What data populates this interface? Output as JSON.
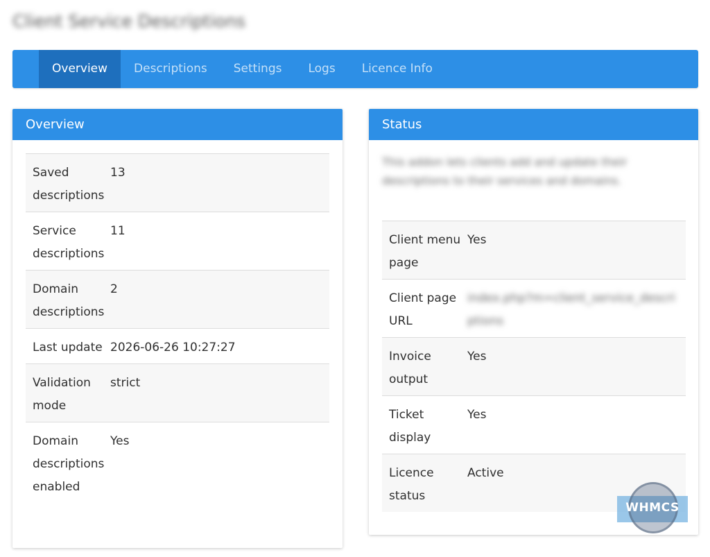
{
  "page": {
    "title": "Client Service Descriptions"
  },
  "nav": {
    "tabs": [
      {
        "label": "Overview",
        "active": true
      },
      {
        "label": "Descriptions",
        "active": false
      },
      {
        "label": "Settings",
        "active": false
      },
      {
        "label": "Logs",
        "active": false
      },
      {
        "label": "Licence Info",
        "active": false
      }
    ]
  },
  "overview": {
    "title": "Overview",
    "rows": [
      {
        "label": "Saved descriptions",
        "value": "13"
      },
      {
        "label": "Service descriptions",
        "value": "11"
      },
      {
        "label": "Domain descriptions",
        "value": "2"
      },
      {
        "label": "Last update",
        "value": "2026-06-26 10:27:27"
      },
      {
        "label": "Validation mode",
        "value": "strict"
      },
      {
        "label": "Domain descriptions enabled",
        "value": "Yes"
      }
    ]
  },
  "status": {
    "title": "Status",
    "description": "This addon lets clients add and update their descriptions to their services and domains.",
    "rows": [
      {
        "label": "Client menu page",
        "value": "Yes"
      },
      {
        "label": "Client page URL",
        "value": "index.php?m=client_service_descriptions"
      },
      {
        "label": "Invoice output",
        "value": "Yes"
      },
      {
        "label": "Ticket display",
        "value": "Yes"
      },
      {
        "label": "Licence status",
        "value": "Active"
      }
    ]
  },
  "watermark": {
    "text": "WHMCS"
  },
  "colors": {
    "accent": "#2d8fe6",
    "accent_dark": "#1e6fbd",
    "row_shade": "#f7f7f7"
  }
}
